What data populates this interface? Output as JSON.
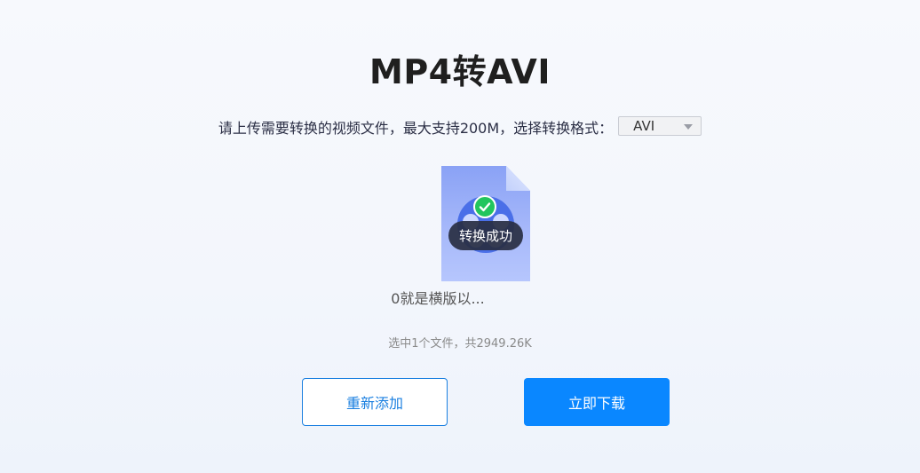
{
  "header": {
    "title": "MP4转AVI"
  },
  "upload": {
    "instruction": "请上传需要转换的视频文件，最大支持200M，选择转换格式：",
    "format_select": {
      "selected": "AVI"
    }
  },
  "file": {
    "status": "转换成功",
    "name": "0就是横版以...",
    "icon": "video-file-icon",
    "status_icon": "check-circle-icon"
  },
  "summary": {
    "text": "选中1个文件，共2949.26K"
  },
  "actions": {
    "add_label": "重新添加",
    "download_label": "立即下载"
  },
  "colors": {
    "primary": "#0a87ff",
    "success": "#22c55e",
    "file_icon": "#8aa2f5"
  }
}
